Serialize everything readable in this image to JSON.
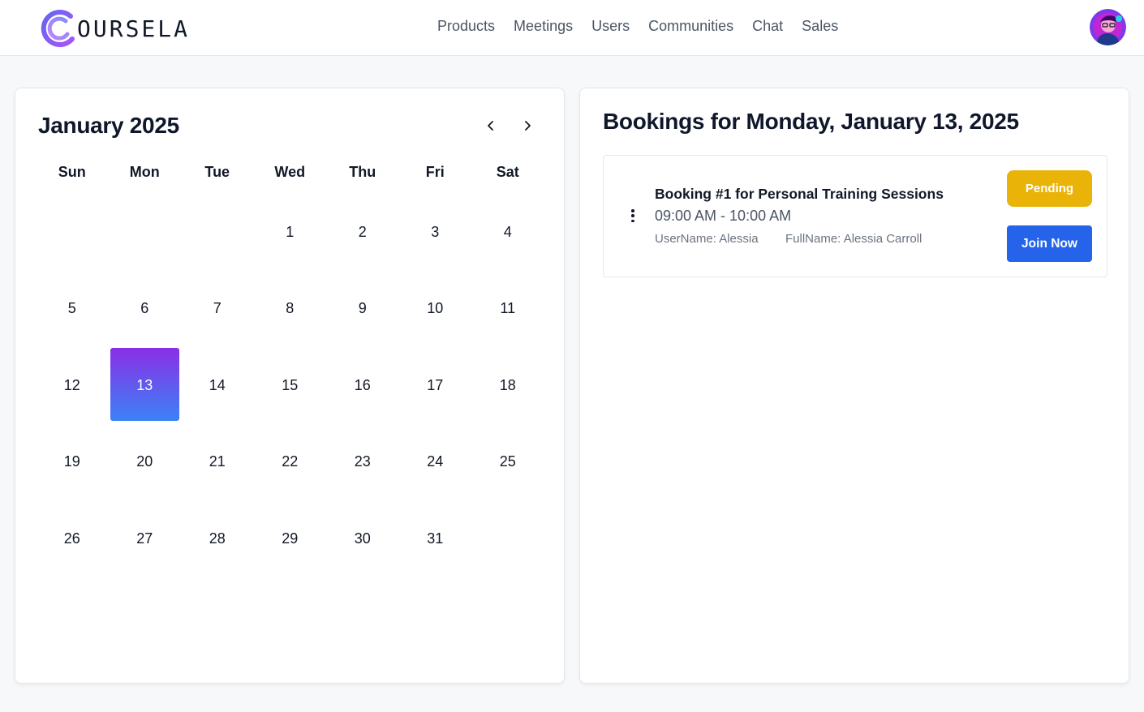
{
  "brand": {
    "name": "OURSELA",
    "logo_icon": "coursela-c-logo"
  },
  "nav": {
    "items": [
      {
        "label": "Products"
      },
      {
        "label": "Meetings"
      },
      {
        "label": "Users"
      },
      {
        "label": "Communities"
      },
      {
        "label": "Chat"
      },
      {
        "label": "Sales"
      }
    ]
  },
  "user": {
    "avatar_icon": "user-avatar"
  },
  "calendar": {
    "title": "January 2025",
    "prev_icon": "chevron-left-icon",
    "next_icon": "chevron-right-icon",
    "weekdays": [
      "Sun",
      "Mon",
      "Tue",
      "Wed",
      "Thu",
      "Fri",
      "Sat"
    ],
    "weeks": [
      [
        "",
        "",
        "",
        "1",
        "2",
        "3",
        "4"
      ],
      [
        "5",
        "6",
        "7",
        "8",
        "9",
        "10",
        "11"
      ],
      [
        "12",
        "13",
        "14",
        "15",
        "16",
        "17",
        "18"
      ],
      [
        "19",
        "20",
        "21",
        "22",
        "23",
        "24",
        "25"
      ],
      [
        "26",
        "27",
        "28",
        "29",
        "30",
        "31",
        ""
      ]
    ],
    "selected_day": "13",
    "selected_gradient": [
      "#8b2fe6",
      "#3b82f6"
    ]
  },
  "bookings": {
    "title": "Bookings for Monday, January 13, 2025",
    "items": [
      {
        "title": "Booking #1 for Personal Training Sessions",
        "time": "09:00 AM - 10:00 AM",
        "username": "UserName: Alessia",
        "fullname": "FullName: Alessia Carroll",
        "status": "Pending",
        "status_color": "#eab308",
        "action_label": "Join Now",
        "action_color": "#2563eb",
        "menu_icon": "more-vertical-icon"
      }
    ]
  }
}
